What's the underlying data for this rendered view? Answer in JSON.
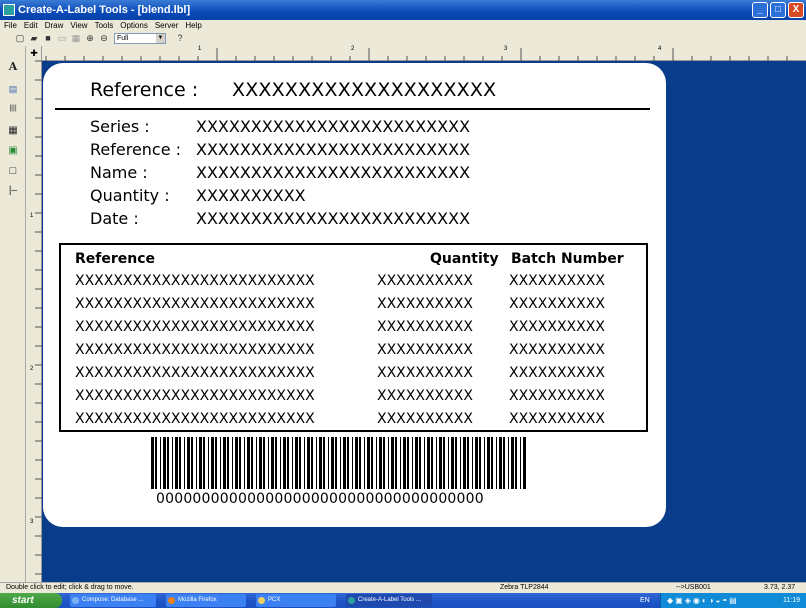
{
  "window": {
    "title": "Create-A-Label Tools - [blend.lbl]",
    "buttons": {
      "minimize": "_",
      "maximize": "□",
      "close": "X"
    }
  },
  "menu": [
    "File",
    "Edit",
    "Draw",
    "View",
    "Tools",
    "Options",
    "Server",
    "Help"
  ],
  "toolbar": {
    "zoom_value": "Full",
    "help_glyph": "?"
  },
  "left_tools": [
    {
      "name": "text-tool",
      "glyph": "A"
    },
    {
      "name": "text-block-tool",
      "glyph": "▤"
    },
    {
      "name": "barcode-tool",
      "glyph": "||||"
    },
    {
      "name": "pdf417-tool",
      "glyph": "▦"
    },
    {
      "name": "image-tool",
      "glyph": "▣"
    },
    {
      "name": "box-tool",
      "glyph": "□"
    },
    {
      "name": "line-tool",
      "glyph": "|–"
    }
  ],
  "rulers": {
    "horizontal": [
      "1",
      "2",
      "3",
      "4"
    ],
    "vertical": [
      "1",
      "2",
      "3"
    ]
  },
  "label": {
    "header": {
      "key": "Reference :",
      "value": "XXXXXXXXXXXXXXXXXXXX"
    },
    "fields": [
      {
        "key": "Series :",
        "value": "XXXXXXXXXXXXXXXXXXXXXXXXX"
      },
      {
        "key": "Reference :",
        "value": "XXXXXXXXXXXXXXXXXXXXXXXXX"
      },
      {
        "key": "Name :",
        "value": "XXXXXXXXXXXXXXXXXXXXXXXXX"
      },
      {
        "key": "Quantity :",
        "value": "XXXXXXXXXX"
      },
      {
        "key": "Date :",
        "value": "XXXXXXXXXXXXXXXXXXXXXXXXX"
      }
    ],
    "table": {
      "columns": [
        "Reference",
        "Quantity",
        "Batch Number"
      ],
      "rows": [
        [
          "XXXXXXXXXXXXXXXXXXXXXXXXX",
          "XXXXXXXXXX",
          "XXXXXXXXXX"
        ],
        [
          "XXXXXXXXXXXXXXXXXXXXXXXXX",
          "XXXXXXXXXX",
          "XXXXXXXXXX"
        ],
        [
          "XXXXXXXXXXXXXXXXXXXXXXXXX",
          "XXXXXXXXXX",
          "XXXXXXXXXX"
        ],
        [
          "XXXXXXXXXXXXXXXXXXXXXXXXX",
          "XXXXXXXXXX",
          "XXXXXXXXXX"
        ],
        [
          "XXXXXXXXXXXXXXXXXXXXXXXXX",
          "XXXXXXXXXX",
          "XXXXXXXXXX"
        ],
        [
          "XXXXXXXXXXXXXXXXXXXXXXXXX",
          "XXXXXXXXXX",
          "XXXXXXXXXX"
        ],
        [
          "XXXXXXXXXXXXXXXXXXXXXXXXX",
          "XXXXXXXXXX",
          "XXXXXXXXXX"
        ]
      ]
    },
    "barcode_text": "000000000000000000000000000000000000"
  },
  "status": {
    "hint": "Double click to edit; click & drag to move.",
    "printer": "Zebra TLP2844",
    "port": "-->USB001",
    "coords": "3.73, 2.37"
  },
  "taskbar": {
    "start": "start",
    "tasks": [
      {
        "label": "Compose: Database ...",
        "icon_color": "#7ab0f0",
        "active": false
      },
      {
        "label": "Mozilla Firefox",
        "icon_color": "#f0801c",
        "active": false
      },
      {
        "label": "PCX",
        "icon_color": "#f0d060",
        "active": false
      },
      {
        "label": "Create-A-Label Tools ...",
        "icon_color": "#2aa0a0",
        "active": true
      }
    ],
    "lang": "EN",
    "clock": "11:19"
  },
  "colors": {
    "canvas": "#0a3c8c",
    "label": "#ffffff",
    "chrome": "#ece9d8"
  }
}
